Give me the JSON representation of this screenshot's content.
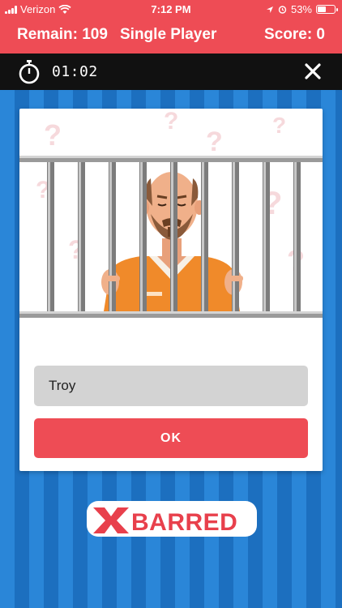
{
  "status_bar": {
    "carrier": "Verizon",
    "time": "7:12 PM",
    "battery": "53%",
    "battery_level": 0.53
  },
  "header": {
    "remain": "Remain: 109",
    "mode": "Single Player",
    "score": "Score: 0"
  },
  "timer": {
    "time": "01:02",
    "icon": "stopwatch-icon",
    "close_icon": "close-icon"
  },
  "card": {
    "input_value": "Troy",
    "button_label": "OK"
  },
  "logo": {
    "text": "BARRED"
  },
  "colors": {
    "accent": "#ee4c55",
    "background_blue": "#1e74c6",
    "timer_bar": "#111111"
  }
}
